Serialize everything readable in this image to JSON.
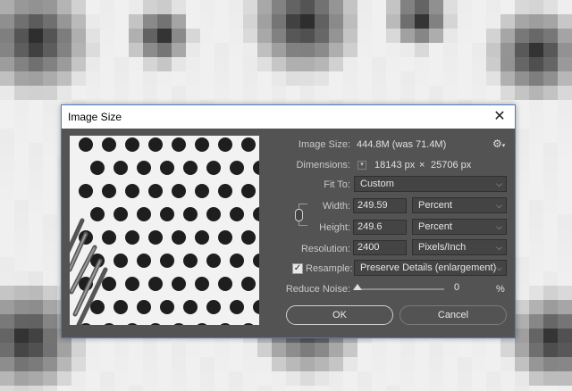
{
  "window": {
    "title": "Image Size",
    "close_glyph": "✕"
  },
  "info": {
    "image_size_label": "Image Size:",
    "image_size_value": "444.8M (was 71.4M)",
    "dimensions_label": "Dimensions:",
    "dimensions_width": "18143 px",
    "dimensions_x": "×",
    "dimensions_height": "25706 px"
  },
  "fit_to": {
    "label": "Fit To:",
    "value": "Custom"
  },
  "width": {
    "label": "Width:",
    "value": "249.59",
    "unit": "Percent"
  },
  "height": {
    "label": "Height:",
    "value": "249.6",
    "unit": "Percent"
  },
  "resolution": {
    "label": "Resolution:",
    "value": "2400",
    "unit": "Pixels/Inch"
  },
  "resample": {
    "label": "Resample:",
    "checked": true,
    "check_glyph": "✓",
    "value": "Preserve Details (enlargement)"
  },
  "reduce_noise": {
    "label": "Reduce Noise:",
    "value": "0",
    "unit": "%",
    "level": 0
  },
  "buttons": {
    "ok": "OK",
    "cancel": "Cancel"
  },
  "icons": {
    "settings": "gear-icon",
    "link": "chain-link-icon",
    "dropdown": "chevron-down-icon"
  },
  "colors": {
    "dialog_bg": "#535353",
    "border_accent": "#4a7fc0"
  }
}
